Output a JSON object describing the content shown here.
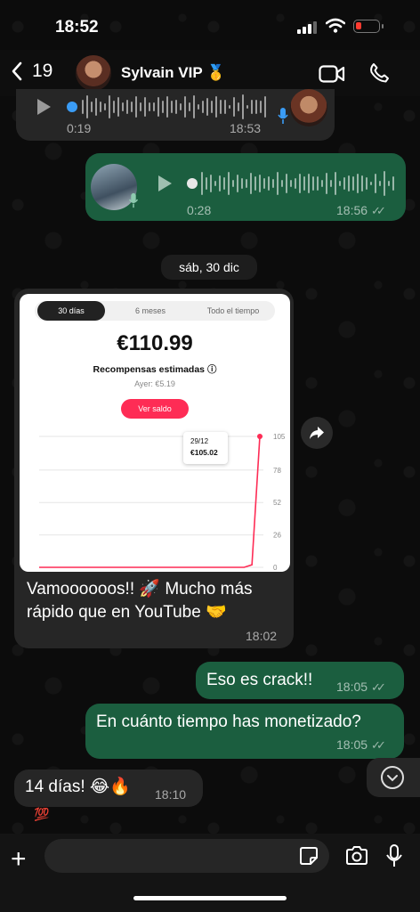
{
  "status_bar": {
    "time": "18:52",
    "battery_color": "#ff3b30"
  },
  "header": {
    "back_count": "19",
    "contact_name": "Sylvain VIP",
    "badge": "🥇"
  },
  "voice_in": {
    "duration": "0:19",
    "time": "18:53"
  },
  "voice_out": {
    "duration": "0:28",
    "time": "18:56"
  },
  "date_separator": "sáb, 30 dic",
  "screenshot": {
    "tabs": [
      "30 días",
      "6 meses",
      "Todo el tiempo"
    ],
    "amount": "€110.99",
    "rewards_label": "Recompensas estimadas ⓘ",
    "yesterday": "Ayer: €5.19",
    "button": "Ver saldo",
    "tooltip_date": "29/12",
    "tooltip_value": "€105.02",
    "accent": "#fe2c55"
  },
  "chart_data": {
    "type": "line",
    "y_ticks": [
      "105",
      "78",
      "52",
      "26",
      "0"
    ],
    "ylim": [
      0,
      105
    ],
    "series": [
      {
        "values": [
          0,
          0,
          0,
          0,
          0,
          0,
          0,
          0,
          0,
          0,
          0,
          0,
          0,
          0,
          0,
          0,
          0,
          0,
          0,
          0,
          0,
          0,
          0,
          0,
          0,
          0,
          0,
          2,
          105.02
        ]
      }
    ]
  },
  "messages": [
    {
      "text_line1": "Vamoooooos!! 🚀 Mucho más",
      "text_line2": "rápido que en YouTube 🤝",
      "time": "18:02"
    },
    {
      "text": "Eso es crack!!",
      "time": "18:05"
    },
    {
      "text": "En cuánto tiempo has monetizado?",
      "time": "18:05"
    },
    {
      "text": "14 días! 😂🔥",
      "time": "18:10"
    }
  ],
  "reaction": "💯",
  "colors": {
    "outgoing": "#1b5e3f",
    "incoming": "#262626"
  }
}
